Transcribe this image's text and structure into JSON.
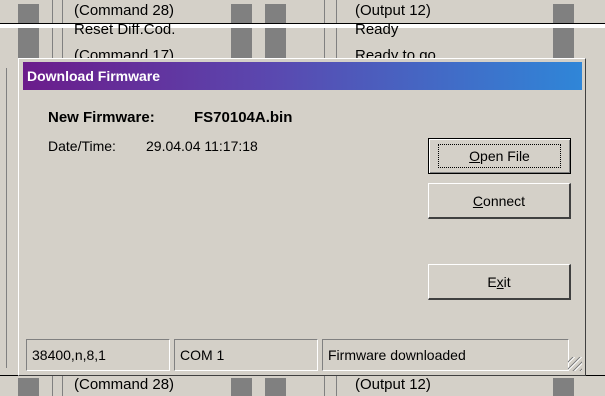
{
  "background": {
    "top_row": {
      "command": "(Command 28)",
      "output": "(Output 12)"
    },
    "second_row": {
      "command": "Reset Diff.Cod.",
      "output": "Ready"
    },
    "third_row": {
      "command": "(Command 17)",
      "output": "Ready to go"
    },
    "bottom_row": {
      "command": "(Command 28)",
      "output": "(Output 12)"
    }
  },
  "dialog": {
    "title": "Download Firmware",
    "new_firmware_label": "New Firmware:",
    "new_firmware_value": "FS70104A.bin",
    "datetime_label": "Date/Time:",
    "datetime_value": "29.04.04 11:17:18",
    "buttons": {
      "open_file": {
        "accel": "O",
        "rest": "pen File"
      },
      "connect": {
        "accel": "C",
        "rest": "onnect"
      },
      "exit": {
        "pre": "E",
        "accel": "x",
        "rest": "it"
      }
    },
    "status": {
      "baud": "38400,n,8,1",
      "port": "COM 1",
      "message": "Firmware downloaded"
    }
  },
  "colors": {
    "title_gradient_start": "#6b1c8b",
    "title_gradient_end": "#2f86d8",
    "window_face": "#d4d0c8"
  }
}
